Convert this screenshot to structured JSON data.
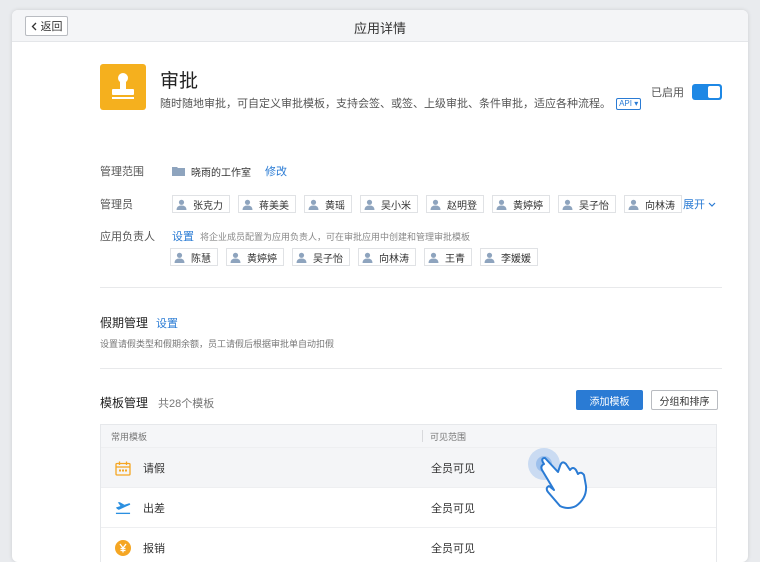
{
  "window": {
    "title": "应用详情",
    "back_label": "返回"
  },
  "app": {
    "name": "审批",
    "description": "随时随地审批，可自定义审批模板，支持会签、或签、上级审批、条件审批，适应各种流程。",
    "api_badge": "API",
    "status_label": "已启用",
    "enabled": true,
    "icon": "stamp-icon",
    "icon_color": "#f5b01e"
  },
  "scope": {
    "label": "管理范围",
    "value": "晓雨的工作室",
    "edit_label": "修改"
  },
  "admins": {
    "label": "管理员",
    "people": [
      "张克力",
      "蒋美美",
      "黄瑶",
      "吴小米",
      "赵明登",
      "黄婷婷",
      "吴子怡",
      "向林涛"
    ],
    "expand_label": "展开"
  },
  "owners": {
    "label": "应用负责人",
    "setting_label": "设置",
    "hint": "将企业成员配置为应用负责人，可在审批应用中创建和管理审批模板",
    "people": [
      "陈慧",
      "黄婷婷",
      "吴子怡",
      "向林涛",
      "王青",
      "李媛媛"
    ]
  },
  "leave": {
    "title": "假期管理",
    "setting_label": "设置",
    "description": "设置请假类型和假期余额，员工请假后根据审批单自动扣假"
  },
  "templates": {
    "title": "模板管理",
    "count_label": "共28个模板",
    "add_label": "添加模板",
    "sort_label": "分组和排序",
    "col_name": "常用模板",
    "col_scope": "可见范围",
    "rows": [
      {
        "name": "请假",
        "scope": "全员可见",
        "icon": "calendar-icon"
      },
      {
        "name": "出差",
        "scope": "全员可见",
        "icon": "airplane-icon"
      },
      {
        "name": "报销",
        "scope": "全员可见",
        "icon": "yen-icon"
      }
    ]
  },
  "colors": {
    "accent": "#2a7bd4",
    "toggle": "#1e88e5",
    "calendar": "#f5a623",
    "airplane": "#2a8fe0",
    "yen": "#f5a623"
  }
}
